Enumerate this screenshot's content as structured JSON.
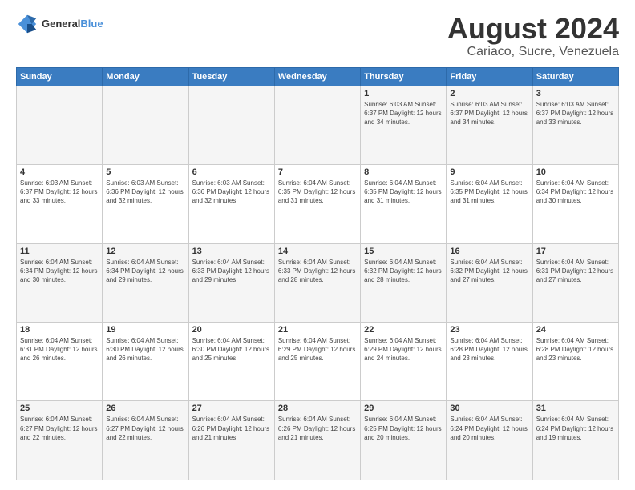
{
  "logo": {
    "line1": "General",
    "line2": "Blue"
  },
  "header": {
    "title": "August 2024",
    "subtitle": "Cariaco, Sucre, Venezuela"
  },
  "weekdays": [
    "Sunday",
    "Monday",
    "Tuesday",
    "Wednesday",
    "Thursday",
    "Friday",
    "Saturday"
  ],
  "weeks": [
    [
      {
        "day": "",
        "info": ""
      },
      {
        "day": "",
        "info": ""
      },
      {
        "day": "",
        "info": ""
      },
      {
        "day": "",
        "info": ""
      },
      {
        "day": "1",
        "info": "Sunrise: 6:03 AM\nSunset: 6:37 PM\nDaylight: 12 hours\nand 34 minutes."
      },
      {
        "day": "2",
        "info": "Sunrise: 6:03 AM\nSunset: 6:37 PM\nDaylight: 12 hours\nand 34 minutes."
      },
      {
        "day": "3",
        "info": "Sunrise: 6:03 AM\nSunset: 6:37 PM\nDaylight: 12 hours\nand 33 minutes."
      }
    ],
    [
      {
        "day": "4",
        "info": "Sunrise: 6:03 AM\nSunset: 6:37 PM\nDaylight: 12 hours\nand 33 minutes."
      },
      {
        "day": "5",
        "info": "Sunrise: 6:03 AM\nSunset: 6:36 PM\nDaylight: 12 hours\nand 32 minutes."
      },
      {
        "day": "6",
        "info": "Sunrise: 6:03 AM\nSunset: 6:36 PM\nDaylight: 12 hours\nand 32 minutes."
      },
      {
        "day": "7",
        "info": "Sunrise: 6:04 AM\nSunset: 6:35 PM\nDaylight: 12 hours\nand 31 minutes."
      },
      {
        "day": "8",
        "info": "Sunrise: 6:04 AM\nSunset: 6:35 PM\nDaylight: 12 hours\nand 31 minutes."
      },
      {
        "day": "9",
        "info": "Sunrise: 6:04 AM\nSunset: 6:35 PM\nDaylight: 12 hours\nand 31 minutes."
      },
      {
        "day": "10",
        "info": "Sunrise: 6:04 AM\nSunset: 6:34 PM\nDaylight: 12 hours\nand 30 minutes."
      }
    ],
    [
      {
        "day": "11",
        "info": "Sunrise: 6:04 AM\nSunset: 6:34 PM\nDaylight: 12 hours\nand 30 minutes."
      },
      {
        "day": "12",
        "info": "Sunrise: 6:04 AM\nSunset: 6:34 PM\nDaylight: 12 hours\nand 29 minutes."
      },
      {
        "day": "13",
        "info": "Sunrise: 6:04 AM\nSunset: 6:33 PM\nDaylight: 12 hours\nand 29 minutes."
      },
      {
        "day": "14",
        "info": "Sunrise: 6:04 AM\nSunset: 6:33 PM\nDaylight: 12 hours\nand 28 minutes."
      },
      {
        "day": "15",
        "info": "Sunrise: 6:04 AM\nSunset: 6:32 PM\nDaylight: 12 hours\nand 28 minutes."
      },
      {
        "day": "16",
        "info": "Sunrise: 6:04 AM\nSunset: 6:32 PM\nDaylight: 12 hours\nand 27 minutes."
      },
      {
        "day": "17",
        "info": "Sunrise: 6:04 AM\nSunset: 6:31 PM\nDaylight: 12 hours\nand 27 minutes."
      }
    ],
    [
      {
        "day": "18",
        "info": "Sunrise: 6:04 AM\nSunset: 6:31 PM\nDaylight: 12 hours\nand 26 minutes."
      },
      {
        "day": "19",
        "info": "Sunrise: 6:04 AM\nSunset: 6:30 PM\nDaylight: 12 hours\nand 26 minutes."
      },
      {
        "day": "20",
        "info": "Sunrise: 6:04 AM\nSunset: 6:30 PM\nDaylight: 12 hours\nand 25 minutes."
      },
      {
        "day": "21",
        "info": "Sunrise: 6:04 AM\nSunset: 6:29 PM\nDaylight: 12 hours\nand 25 minutes."
      },
      {
        "day": "22",
        "info": "Sunrise: 6:04 AM\nSunset: 6:29 PM\nDaylight: 12 hours\nand 24 minutes."
      },
      {
        "day": "23",
        "info": "Sunrise: 6:04 AM\nSunset: 6:28 PM\nDaylight: 12 hours\nand 23 minutes."
      },
      {
        "day": "24",
        "info": "Sunrise: 6:04 AM\nSunset: 6:28 PM\nDaylight: 12 hours\nand 23 minutes."
      }
    ],
    [
      {
        "day": "25",
        "info": "Sunrise: 6:04 AM\nSunset: 6:27 PM\nDaylight: 12 hours\nand 22 minutes."
      },
      {
        "day": "26",
        "info": "Sunrise: 6:04 AM\nSunset: 6:27 PM\nDaylight: 12 hours\nand 22 minutes."
      },
      {
        "day": "27",
        "info": "Sunrise: 6:04 AM\nSunset: 6:26 PM\nDaylight: 12 hours\nand 21 minutes."
      },
      {
        "day": "28",
        "info": "Sunrise: 6:04 AM\nSunset: 6:26 PM\nDaylight: 12 hours\nand 21 minutes."
      },
      {
        "day": "29",
        "info": "Sunrise: 6:04 AM\nSunset: 6:25 PM\nDaylight: 12 hours\nand 20 minutes."
      },
      {
        "day": "30",
        "info": "Sunrise: 6:04 AM\nSunset: 6:24 PM\nDaylight: 12 hours\nand 20 minutes."
      },
      {
        "day": "31",
        "info": "Sunrise: 6:04 AM\nSunset: 6:24 PM\nDaylight: 12 hours\nand 19 minutes."
      }
    ]
  ]
}
